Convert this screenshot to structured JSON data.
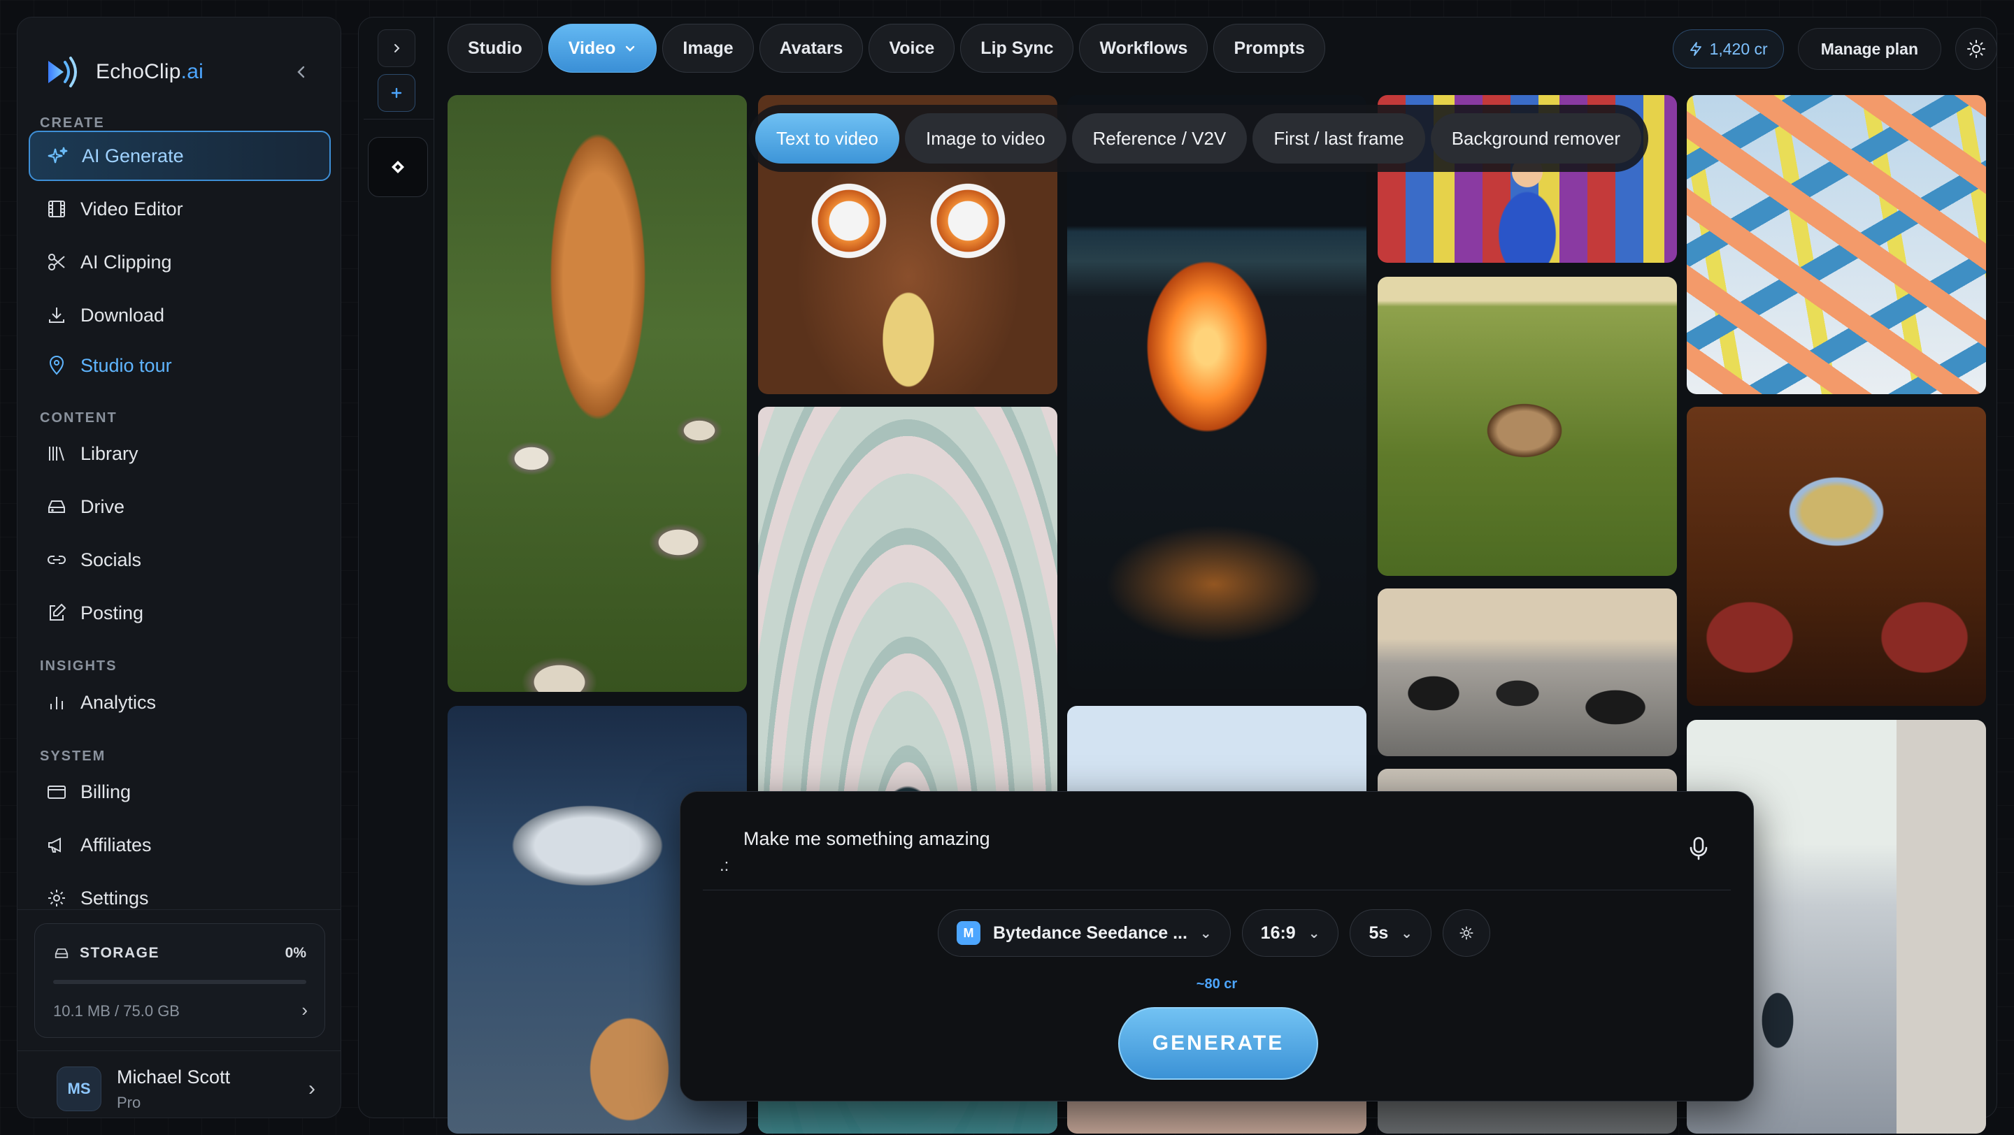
{
  "brand": {
    "name": "EchoClip",
    "suffix": ".ai"
  },
  "sidebar": {
    "sections": {
      "create": "CREATE",
      "content": "CONTENT",
      "insights": "INSIGHTS",
      "system": "SYSTEM"
    },
    "items": {
      "ai_generate": "AI Generate",
      "video_editor": "Video Editor",
      "ai_clipping": "AI Clipping",
      "download": "Download",
      "studio_tour": "Studio tour",
      "library": "Library",
      "drive": "Drive",
      "socials": "Socials",
      "posting": "Posting",
      "analytics": "Analytics",
      "billing": "Billing",
      "affiliates": "Affiliates",
      "settings": "Settings"
    },
    "storage": {
      "label": "STORAGE",
      "percent": "0%",
      "used": "10.1 MB / 75.0 GB",
      "fraction": 0.0
    },
    "user": {
      "initials": "MS",
      "name": "Michael Scott",
      "plan": "Pro"
    }
  },
  "top_tabs": [
    "Studio",
    "Video",
    "Image",
    "Avatars",
    "Voice",
    "Lip Sync",
    "Workflows",
    "Prompts"
  ],
  "active_tab": "Video",
  "header": {
    "credits": "1,420 cr",
    "manage_plan": "Manage plan"
  },
  "modes": [
    "Text to video",
    "Image to video",
    "Reference / V2V",
    "First / last frame",
    "Background remover"
  ],
  "prompt": {
    "value": "Make me something amazing",
    "model": "Bytedance Seedance ...",
    "model_badge": "M",
    "aspect": "16:9",
    "duration": "5s",
    "cost": "~80 cr",
    "generate": "GENERATE"
  },
  "colors": {
    "accent": "#4da6ff",
    "active_tab": "#4aa3e6",
    "bg": "#0c0e12"
  }
}
